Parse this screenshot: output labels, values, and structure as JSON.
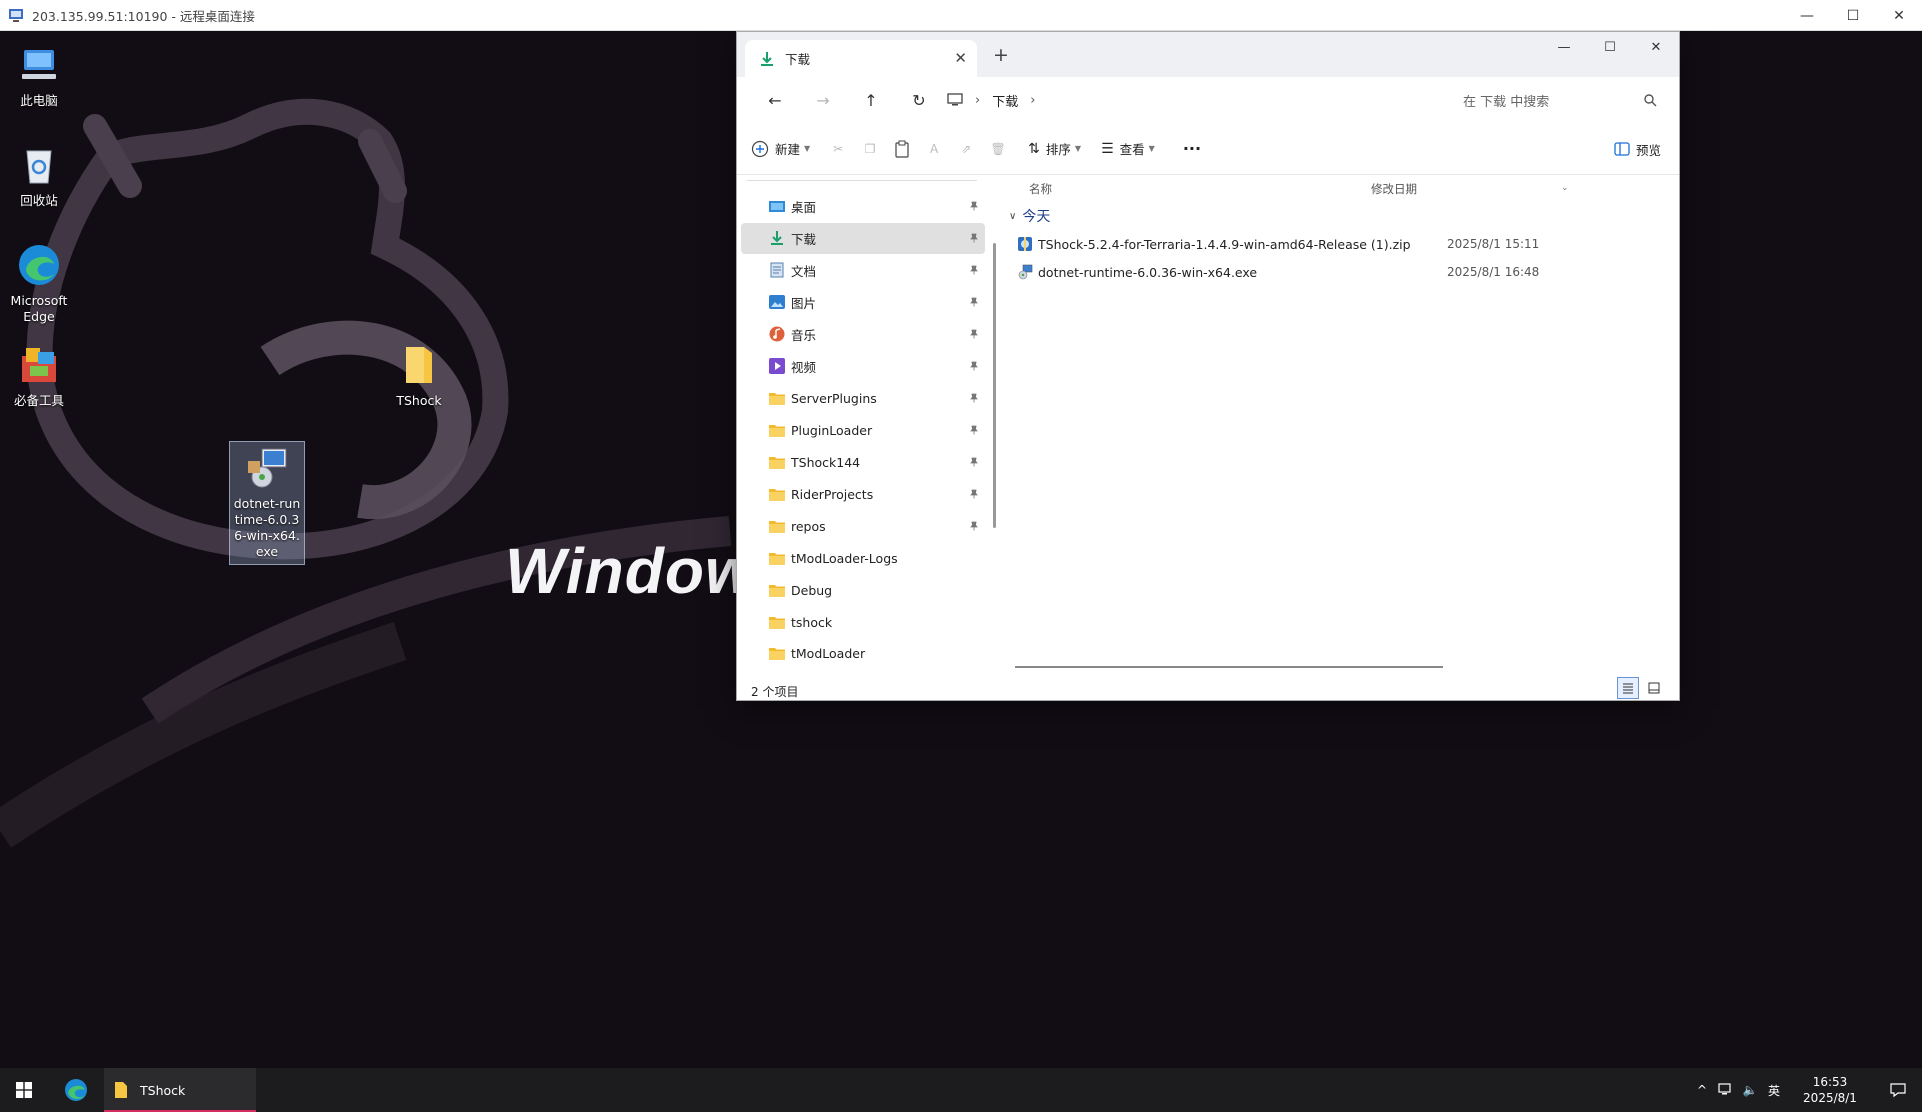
{
  "rdp": {
    "title": "203.135.99.51:10190 - 远程桌面连接"
  },
  "desktop": {
    "watermark_text": "Window",
    "icons": [
      {
        "label": "此电脑",
        "icon": "this-pc-icon"
      },
      {
        "label": "回收站",
        "icon": "recycle-bin-icon"
      },
      {
        "label": "Microsoft Edge",
        "icon": "edge-icon"
      },
      {
        "label": "必备工具",
        "icon": "toolbox-icon"
      },
      {
        "label": "TShock",
        "icon": "folder-icon"
      },
      {
        "label": "dotnet-runtime-6.0.36-win-x64.exe",
        "icon": "installer-icon"
      }
    ]
  },
  "explorer": {
    "tab_label": "下载",
    "new_tab": "+",
    "breadcrumb": {
      "current": "下载"
    },
    "search_placeholder": "在 下载 中搜索",
    "toolbar": {
      "new_label": "新建",
      "sort_label": "排序",
      "view_label": "查看",
      "more_label": "···",
      "preview_label": "预览"
    },
    "nav_items": [
      {
        "label": "桌面",
        "icon": "desktop-icon",
        "pinned": true
      },
      {
        "label": "下载",
        "icon": "download-icon",
        "pinned": true,
        "selected": true
      },
      {
        "label": "文档",
        "icon": "document-icon",
        "pinned": true
      },
      {
        "label": "图片",
        "icon": "pictures-icon",
        "pinned": true
      },
      {
        "label": "音乐",
        "icon": "music-icon",
        "pinned": true
      },
      {
        "label": "视频",
        "icon": "video-icon",
        "pinned": true
      },
      {
        "label": "ServerPlugins",
        "icon": "folder-icon",
        "pinned": true
      },
      {
        "label": "PluginLoader",
        "icon": "folder-icon",
        "pinned": true
      },
      {
        "label": "TShock144",
        "icon": "folder-icon",
        "pinned": true
      },
      {
        "label": "RiderProjects",
        "icon": "folder-icon",
        "pinned": true
      },
      {
        "label": "repos",
        "icon": "folder-icon",
        "pinned": true
      },
      {
        "label": "tModLoader-Logs",
        "icon": "folder-icon",
        "pinned": false
      },
      {
        "label": "Debug",
        "icon": "folder-icon",
        "pinned": false
      },
      {
        "label": "tshock",
        "icon": "folder-icon",
        "pinned": false
      },
      {
        "label": "tModLoader",
        "icon": "folder-icon",
        "pinned": false
      }
    ],
    "columns": {
      "name": "名称",
      "date": "修改日期"
    },
    "group_label": "今天",
    "files": [
      {
        "name": "TShock-5.2.4-for-Terraria-1.4.4.9-win-amd64-Release (1).zip",
        "date": "2025/8/1 15:11",
        "icon": "zip-icon"
      },
      {
        "name": "dotnet-runtime-6.0.36-win-x64.exe",
        "date": "2025/8/1 16:48",
        "icon": "installer-icon"
      }
    ],
    "status": "2 个项目"
  },
  "taskbar": {
    "active_app": "TShock",
    "ime": "英",
    "time": "16:53",
    "date": "2025/8/1"
  }
}
